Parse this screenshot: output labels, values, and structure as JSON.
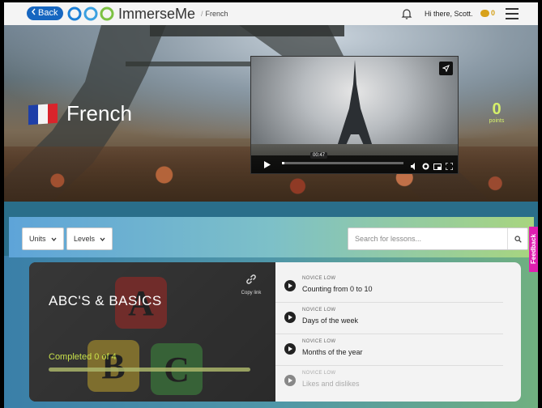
{
  "topbar": {
    "back_label": "Back",
    "brand": "ImmerseMe",
    "breadcrumb": "French",
    "greeting": "Hi there, Scott.",
    "coins": "0"
  },
  "hero": {
    "language": "French",
    "points_value": "0",
    "points_label": "points",
    "video": {
      "time": "00:47",
      "progress": 0.02
    }
  },
  "filters": {
    "units_label": "Units",
    "levels_label": "Levels",
    "search_placeholder": "Search for lessons..."
  },
  "feedback_label": "Feedback",
  "unit_card": {
    "title": "ABC'S & BASICS",
    "copy_link_label": "Copy link",
    "completed_text": "Completed 0 of 4",
    "completed_fraction": 0,
    "blocks": [
      "A",
      "B",
      "C"
    ],
    "lessons": [
      {
        "level": "NOVICE LOW",
        "name": "Counting from 0 to 10"
      },
      {
        "level": "NOVICE LOW",
        "name": "Days of the week"
      },
      {
        "level": "NOVICE LOW",
        "name": "Months of the year"
      },
      {
        "level": "NOVICE LOW",
        "name": "Likes and dislikes"
      }
    ]
  },
  "colors": {
    "accent": "#1666c0",
    "feedback": "#e01fb0",
    "progress": "#c8e04a"
  }
}
